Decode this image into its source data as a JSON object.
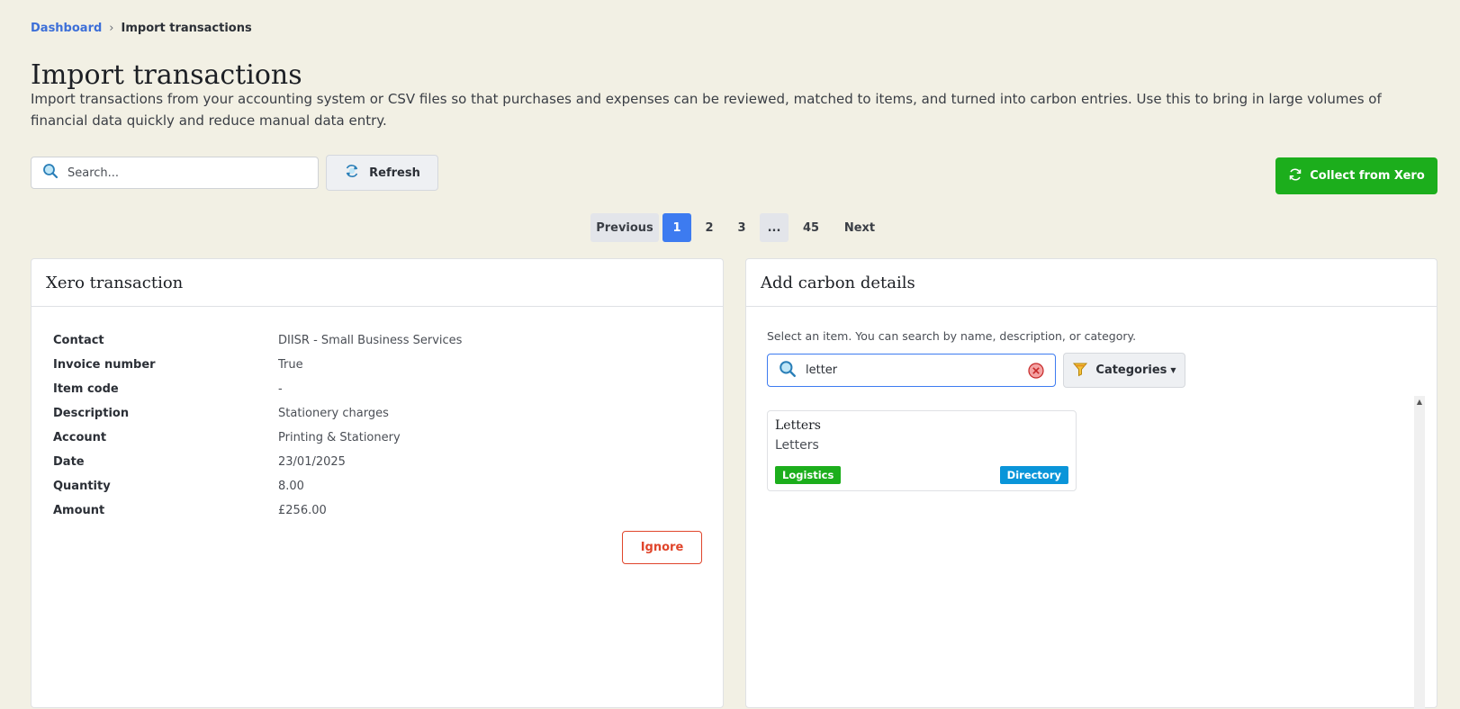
{
  "breadcrumb": {
    "home": "Dashboard",
    "separator": "›",
    "current": "Import transactions"
  },
  "page": {
    "title": "Import transactions",
    "description": "Import transactions from your accounting system or CSV files so that purchases and expenses can be reviewed, matched to items, and turned into carbon entries. Use this to bring in large volumes of financial data quickly and reduce manual data entry."
  },
  "toolbar": {
    "search_placeholder": "Search...",
    "refresh_label": "Refresh",
    "collect_label": "Collect from Xero"
  },
  "pagination": {
    "previous": "Previous",
    "pages": [
      "1",
      "2",
      "3"
    ],
    "active_page": "1",
    "ellipsis": "...",
    "last_page": "45",
    "next": "Next"
  },
  "transaction_panel": {
    "title": "Xero transaction",
    "fields": [
      {
        "label": "Contact",
        "value": "DIISR - Small Business Services"
      },
      {
        "label": "Invoice number",
        "value": "True"
      },
      {
        "label": "Item code",
        "value": "-"
      },
      {
        "label": "Description",
        "value": "Stationery charges"
      },
      {
        "label": "Account",
        "value": "Printing & Stationery"
      },
      {
        "label": "Date",
        "value": "23/01/2025"
      },
      {
        "label": "Quantity",
        "value": "8.00"
      },
      {
        "label": "Amount",
        "value": "£256.00"
      }
    ],
    "ignore_label": "Ignore"
  },
  "carbon_panel": {
    "title": "Add carbon details",
    "hint": "Select an item. You can search by name, description, or category.",
    "search_value": "letter",
    "categories_label": "Categories",
    "results": [
      {
        "title": "Letters",
        "description": "Letters",
        "badge_left": "Logistics",
        "badge_right": "Directory"
      }
    ]
  },
  "icons": {
    "search": "search-icon",
    "refresh": "refresh-icon",
    "sync": "sync-icon",
    "clear": "clear-icon",
    "filter": "filter-funnel-icon"
  },
  "colors": {
    "background": "#f2f0e4",
    "primary": "#3d7bf0",
    "link": "#3d6fd8",
    "success": "#1cae1c",
    "danger": "#e0452b",
    "info": "#0a95d9"
  }
}
